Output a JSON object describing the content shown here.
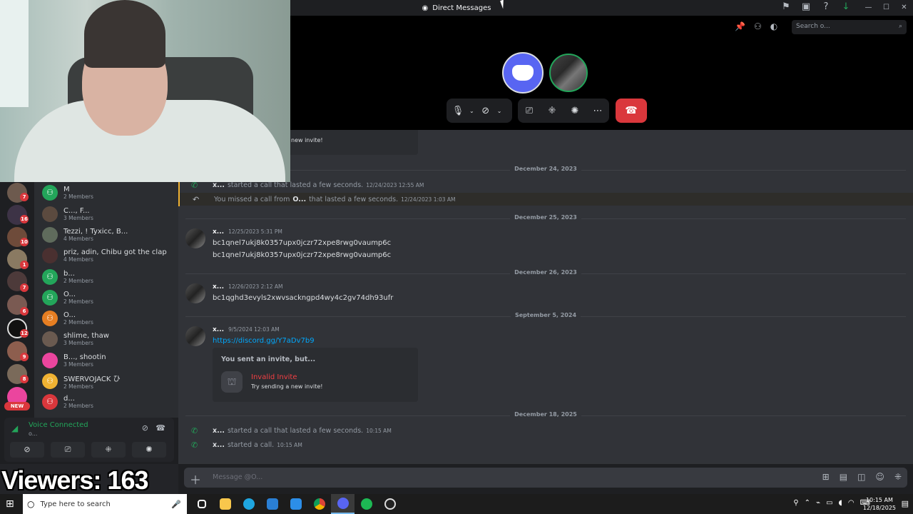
{
  "window": {
    "title": "Direct Messages"
  },
  "header": {
    "search_placeholder": "Search o..."
  },
  "sidebar": {
    "server_badges": [
      "7",
      "16",
      "10",
      "1",
      "7",
      "6",
      "12",
      "9",
      "8"
    ],
    "new_badge": "NEW",
    "dms": [
      {
        "name": "M",
        "sub": "2 Members",
        "color": "#23a55a"
      },
      {
        "name": "C..., F...",
        "sub": "3 Members",
        "color": "#5b4a3f"
      },
      {
        "name": "Tezzi, ! Tyxicc, B...",
        "sub": "4 Members",
        "color": "#5f6b5c"
      },
      {
        "name": "priz, adin, Chibu got the clap",
        "sub": "4 Members",
        "color": "#4a3030"
      },
      {
        "name": "b...",
        "sub": "2 Members",
        "color": "#23a55a"
      },
      {
        "name": "O...",
        "sub": "2 Members",
        "color": "#23a55a"
      },
      {
        "name": "O...",
        "sub": "2 Members",
        "color": "#e67e22"
      },
      {
        "name": "shlime, thaw",
        "sub": "3 Members",
        "color": "#6a5a50"
      },
      {
        "name": "B..., shootin",
        "sub": "3 Members",
        "color": "#eb459e"
      },
      {
        "name": "SWERVOJACK ひ",
        "sub": "2 Members",
        "color": "#f0b232"
      },
      {
        "name": "d...",
        "sub": "2 Members",
        "color": "#da373c"
      }
    ]
  },
  "voice": {
    "title": "Voice Connected",
    "sub": "o..."
  },
  "overlay": {
    "viewers": "Viewers: 163"
  },
  "chat": {
    "top_invite_text": "new invite!",
    "dates": [
      "December 24, 2023",
      "December 25, 2023",
      "December 26, 2023",
      "September 5, 2024",
      "December 18, 2025"
    ],
    "call1": {
      "name": "x...",
      "text": "started a call that lasted a few seconds.",
      "ts": "12/24/2023 12:55 AM"
    },
    "missed": {
      "pre": "You missed a call from",
      "name": "O...",
      "text": "that lasted a few seconds.",
      "ts": "12/24/2023 1:03 AM"
    },
    "msg1": {
      "name": "x...",
      "ts": "12/25/2023 5:31 PM",
      "lines": [
        "bc1qnel7ukj8k0357upx0jczr72xpe8rwg0vaump6c",
        "bc1qnel7ukj8k0357upx0jczr72xpe8rwg0vaump6c"
      ]
    },
    "msg2": {
      "name": "x...",
      "ts": "12/26/2023 2:12 AM",
      "line": "bc1qghd3evyls2xwvsackngpd4wy4c2gv74dh93ufr"
    },
    "msg3": {
      "name": "x...",
      "ts": "9/5/2024 12:03 AM",
      "link": "https://discord.gg/Y7aDv7b9",
      "invite": {
        "title": "You sent an invite, but...",
        "status": "Invalid Invite",
        "sub": "Try sending a new invite!"
      }
    },
    "call2": {
      "name": "x...",
      "text": "started a call that lasted a few seconds.",
      "ts": "10:15 AM"
    },
    "call3": {
      "name": "x...",
      "text": "started a call.",
      "ts": "10:15 AM"
    }
  },
  "composer": {
    "placeholder": "Message @O..."
  },
  "taskbar": {
    "search_placeholder": "Type here to search",
    "time": "10:15 AM",
    "date": "12/18/2025"
  }
}
